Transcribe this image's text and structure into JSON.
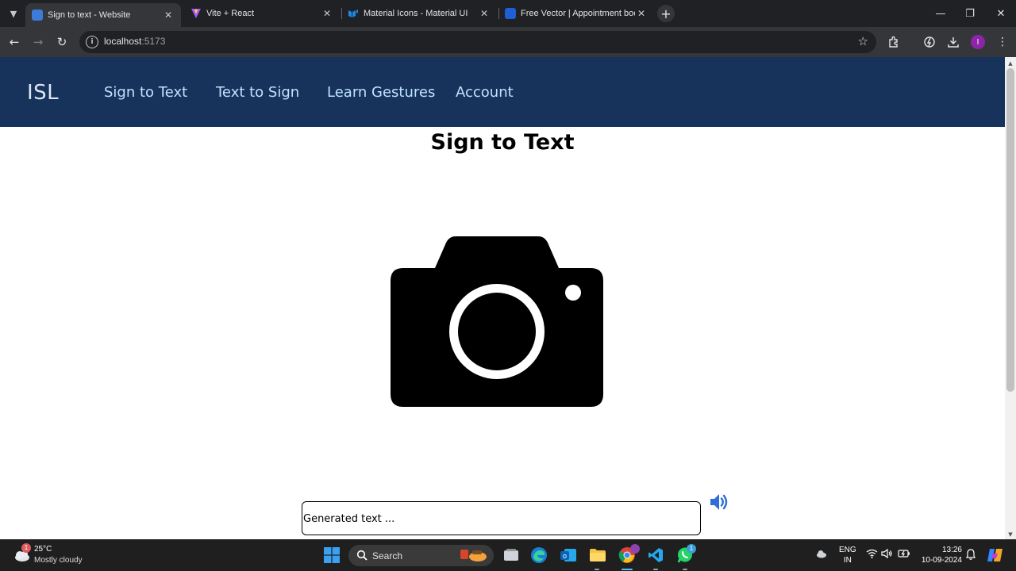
{
  "browser": {
    "tabs": [
      {
        "title": "Sign to text - Website",
        "active": true,
        "favicon_color": "#3c7bd6"
      },
      {
        "title": "Vite + React",
        "active": false,
        "favicon_color": "#a259ff"
      },
      {
        "title": "Material Icons - Material UI",
        "active": false,
        "favicon_color": "#1e88e5"
      },
      {
        "title": "Free Vector | Appointment booking",
        "active": false,
        "favicon_color": "#1e5fd6"
      }
    ],
    "url_host": "localhost",
    "url_port": ":5173",
    "profile_initial": "I"
  },
  "app": {
    "logo": "ISL",
    "nav": [
      "Sign to Text",
      "Text to Sign",
      "Learn Gestures",
      "Account"
    ],
    "page_title": "Sign to Text",
    "output_placeholder": "Generated text ..."
  },
  "taskbar": {
    "weather_badge": "1",
    "temperature": "25°C",
    "weather_desc": "Mostly cloudy",
    "search_label": "Search",
    "whatsapp_badge": "1",
    "lang_line1": "ENG",
    "lang_line2": "IN",
    "time": "13:26",
    "date": "10-09-2024"
  },
  "colors": {
    "navbar_bg": "#17325b",
    "nav_link": "#bfe3ff",
    "speaker": "#2f6fd6"
  }
}
